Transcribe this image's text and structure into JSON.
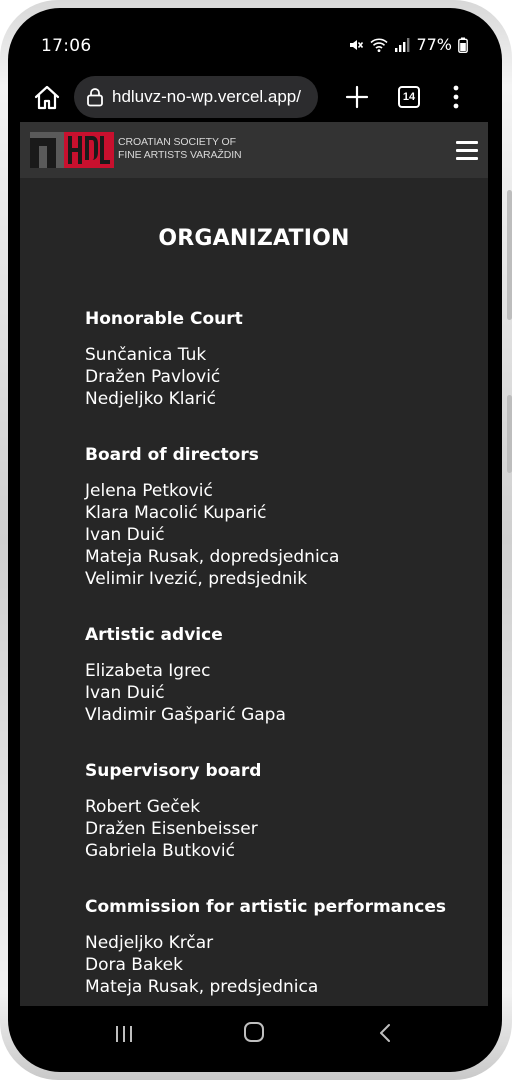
{
  "status_bar": {
    "time": "17:06",
    "battery": "77%"
  },
  "browser": {
    "url": "hdluvz-no-wp.vercel.app/",
    "tab_count": "14"
  },
  "site": {
    "logo_lines": [
      "CROATIAN SOCIETY OF",
      "FINE ARTISTS VARAŽDIN"
    ],
    "page_title": "ORGANIZATION",
    "sections": [
      {
        "heading": "Honorable Court",
        "members": [
          "Sunčanica Tuk",
          "Dražen Pavlović",
          "Nedjeljko Klarić"
        ]
      },
      {
        "heading": "Board of directors",
        "members": [
          "Jelena Petković",
          "Klara Macolić Kuparić",
          "Ivan Duić",
          "Mateja Rusak, dopredsjednica",
          "Velimir Ivezić, predsjednik"
        ]
      },
      {
        "heading": "Artistic advice",
        "members": [
          "Elizabeta Igrec",
          "Ivan Duić",
          "Vladimir Gašparić Gapa"
        ]
      },
      {
        "heading": "Supervisory board",
        "members": [
          "Robert Geček",
          "Dražen Eisenbeisser",
          "Gabriela Butković"
        ]
      },
      {
        "heading": "Commission for artistic performances",
        "members": [
          "Nedjeljko Krčar",
          "Dora Bakek",
          "Mateja Rusak, predsjednica"
        ]
      }
    ]
  },
  "colors": {
    "site_background": "#262626",
    "header_background": "#333333",
    "logo_red": "#c8102e"
  },
  "icons": {
    "status": [
      "mute-icon",
      "wifi-icon",
      "signal-icon",
      "battery-icon"
    ],
    "toolbar": [
      "home-icon",
      "lock-icon",
      "plus-icon",
      "tabs-icon",
      "more-vert-icon"
    ],
    "navigation": [
      "recent-apps-icon",
      "home-nav-icon",
      "back-icon"
    ]
  }
}
